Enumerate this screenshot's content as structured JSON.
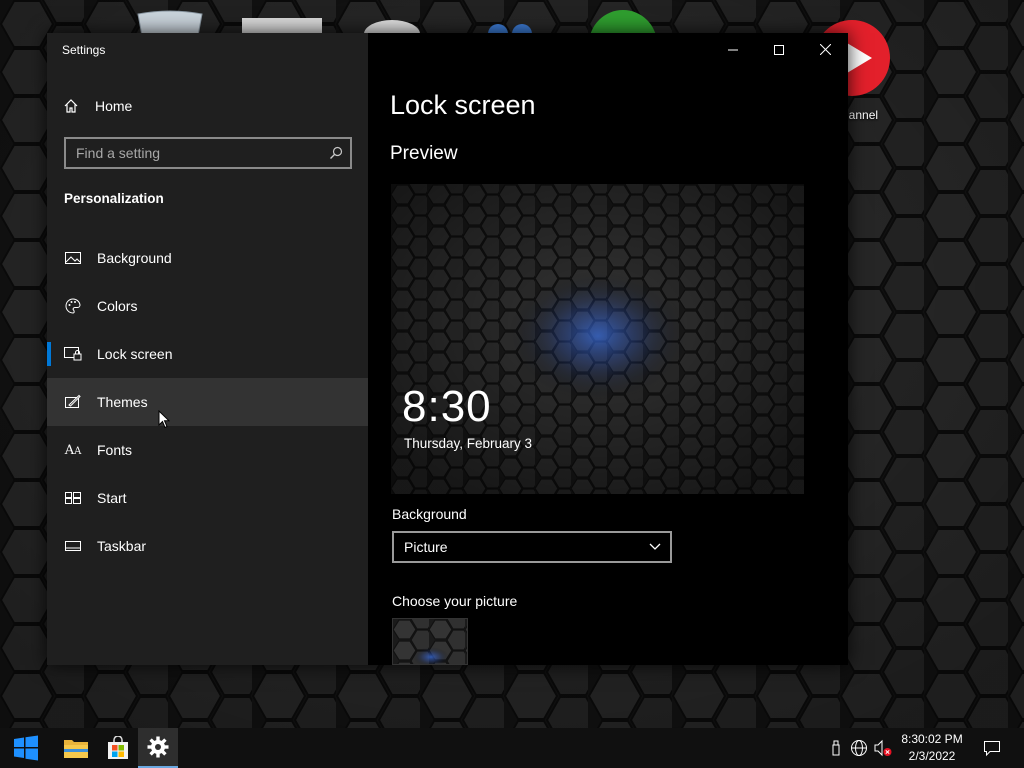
{
  "window": {
    "title": "Settings",
    "minimize_glyph": "—",
    "maximize_glyph": "☐",
    "close_glyph": "✕"
  },
  "sidebar": {
    "home": {
      "label": "Home",
      "icon": "home-icon"
    },
    "search": {
      "placeholder": "Find a setting",
      "icon": "search-icon"
    },
    "section_title": "Personalization",
    "items": [
      {
        "label": "Background",
        "icon": "picture-icon",
        "selected": false,
        "hover": false
      },
      {
        "label": "Colors",
        "icon": "palette-icon",
        "selected": false,
        "hover": false
      },
      {
        "label": "Lock screen",
        "icon": "lock-screen-icon",
        "selected": true,
        "hover": false
      },
      {
        "label": "Themes",
        "icon": "brush-icon",
        "selected": false,
        "hover": true
      },
      {
        "label": "Fonts",
        "icon": "fonts-icon",
        "selected": false,
        "hover": false
      },
      {
        "label": "Start",
        "icon": "start-icon",
        "selected": false,
        "hover": false
      },
      {
        "label": "Taskbar",
        "icon": "taskbar-icon",
        "selected": false,
        "hover": false
      }
    ]
  },
  "main": {
    "title": "Lock screen",
    "preview_title": "Preview",
    "preview": {
      "time": "8:30",
      "date": "Thursday, February 3"
    },
    "background_label": "Background",
    "background_value": "Picture",
    "choose_picture_label": "Choose your picture"
  },
  "desktop": {
    "partial_label": "hannel"
  },
  "taskbar": {
    "items": [
      {
        "name": "start-button",
        "icon": "windows-logo-icon"
      },
      {
        "name": "file-explorer",
        "icon": "folder-icon"
      },
      {
        "name": "microsoft-store",
        "icon": "store-icon"
      },
      {
        "name": "settings",
        "icon": "gear-icon",
        "active": true
      }
    ],
    "clock": {
      "time": "8:30:02 PM",
      "date": "2/3/2022"
    }
  },
  "colors": {
    "accent": "#0078d7",
    "sidebar_bg": "#1f1f1f",
    "content_bg": "#000000",
    "hover_bg": "#333333"
  }
}
